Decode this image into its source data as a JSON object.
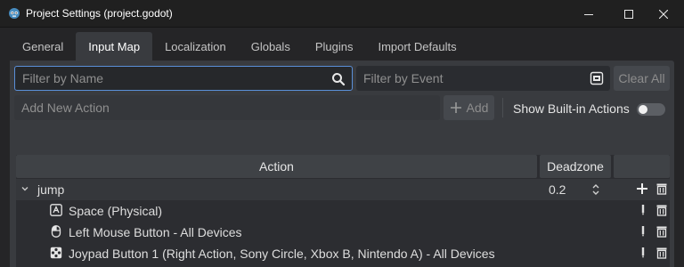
{
  "window": {
    "title": "Project Settings (project.godot)",
    "controls": [
      "minimize-icon",
      "maximize-icon",
      "close-icon"
    ]
  },
  "tabs": [
    {
      "label": "General",
      "active": false
    },
    {
      "label": "Input Map",
      "active": true
    },
    {
      "label": "Localization",
      "active": false
    },
    {
      "label": "Globals",
      "active": false
    },
    {
      "label": "Plugins",
      "active": false
    },
    {
      "label": "Import Defaults",
      "active": false
    }
  ],
  "filters": {
    "name_placeholder": "Filter by Name",
    "event_placeholder": "Filter by Event",
    "clear_all_label": "Clear All"
  },
  "add_action": {
    "placeholder": "Add New Action",
    "add_label": "Add",
    "show_builtin_label": "Show Built-in Actions",
    "show_builtin_on": false
  },
  "table": {
    "headers": {
      "action": "Action",
      "deadzone": "Deadzone"
    },
    "actions": [
      {
        "name": "jump",
        "deadzone": "0.2",
        "expanded": true,
        "events": [
          {
            "label": "Space (Physical)",
            "icon": "keyboard-icon"
          },
          {
            "label": "Left Mouse Button - All Devices",
            "icon": "mouse-icon"
          },
          {
            "label": "Joypad Button 1 (Right Action, Sony Circle, Xbox B, Nintendo A) - All Devices",
            "icon": "joypad-icon"
          }
        ]
      }
    ]
  },
  "colors": {
    "accent_focus": "#5a8fd8",
    "panel": "#393b3f",
    "tree_bg": "#2c2d31"
  }
}
